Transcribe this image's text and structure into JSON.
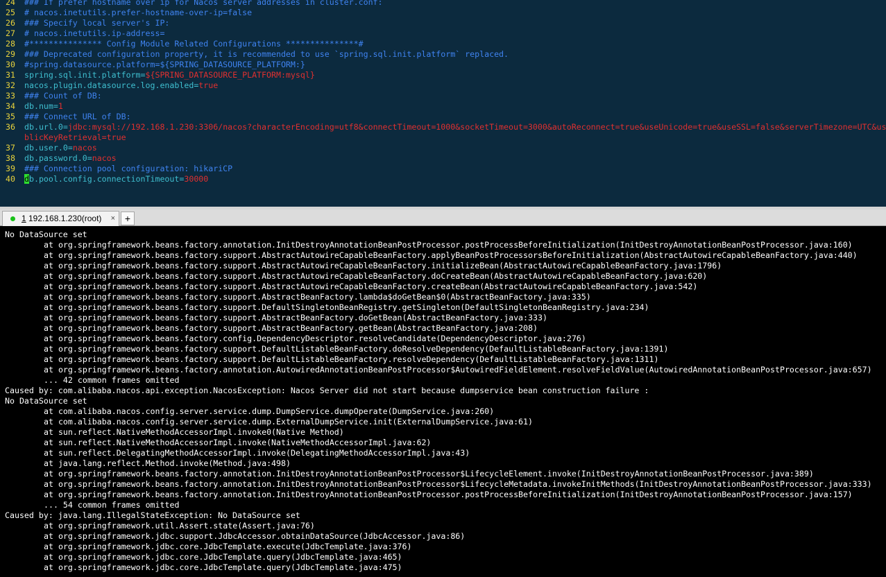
{
  "editor": {
    "lines": [
      {
        "num": "24",
        "kind": "comment",
        "text": "### If prefer hostname over ip for Nacos server addresses in cluster.conf:"
      },
      {
        "num": "25",
        "kind": "comment",
        "text": "# nacos.inetutils.prefer-hostname-over-ip=false"
      },
      {
        "num": "26",
        "kind": "comment",
        "text": "### Specify local server's IP:"
      },
      {
        "num": "27",
        "kind": "comment",
        "text": "# nacos.inetutils.ip-address="
      },
      {
        "num": "28",
        "kind": "comment",
        "text": "#*************** Config Module Related Configurations ***************#"
      },
      {
        "num": "29",
        "kind": "comment",
        "text": "### Deprecated configuration property, it is recommended to use `spring.sql.init.platform` replaced."
      },
      {
        "num": "30",
        "kind": "comment",
        "text": "#spring.datasource.platform=${SPRING_DATASOURCE_PLATFORM:}"
      },
      {
        "num": "31",
        "kind": "kv",
        "key": "spring.sql.init.platform",
        "value": "${SPRING_DATASOURCE_PLATFORM:mysql}"
      },
      {
        "num": "32",
        "kind": "kv",
        "key": "nacos.plugin.datasource.log.enabled",
        "value": "true"
      },
      {
        "num": "33",
        "kind": "comment",
        "text": "### Count of DB:"
      },
      {
        "num": "34",
        "kind": "kv",
        "key": "db.num",
        "value": "1"
      },
      {
        "num": "35",
        "kind": "comment",
        "text": "### Connect URL of DB:"
      },
      {
        "num": "36",
        "kind": "kv",
        "key": "db.url.0",
        "value": "jdbc:mysql://192.168.1.230:3306/nacos?characterEncoding=utf8&connectTimeout=1000&socketTimeout=3000&autoReconnect=true&useUnicode=true&useSSL=false&serverTimezone=UTC&us"
      },
      {
        "num": "",
        "kind": "cont",
        "value": "blicKeyRetrieval=true"
      },
      {
        "num": "37",
        "kind": "kv",
        "key": "db.user.0",
        "value": "nacos"
      },
      {
        "num": "38",
        "kind": "kv",
        "key": "db.password.0",
        "value": "nacos"
      },
      {
        "num": "39",
        "kind": "comment",
        "text": "### Connection pool configuration: hikariCP"
      },
      {
        "num": "40",
        "kind": "kv",
        "cursor": "d",
        "key": "b.pool.config.connectionTimeout",
        "value": "30000"
      }
    ]
  },
  "tab": {
    "number": "1",
    "label": " 192.168.1.230(root)",
    "close_glyph": "×",
    "add_glyph": "+"
  },
  "terminal": {
    "lines": [
      {
        "indent": false,
        "text": "No DataSource set"
      },
      {
        "indent": true,
        "text": "at org.springframework.beans.factory.annotation.InitDestroyAnnotationBeanPostProcessor.postProcessBeforeInitialization(InitDestroyAnnotationBeanPostProcessor.java:160)"
      },
      {
        "indent": true,
        "text": "at org.springframework.beans.factory.support.AbstractAutowireCapableBeanFactory.applyBeanPostProcessorsBeforeInitialization(AbstractAutowireCapableBeanFactory.java:440)"
      },
      {
        "indent": true,
        "text": "at org.springframework.beans.factory.support.AbstractAutowireCapableBeanFactory.initializeBean(AbstractAutowireCapableBeanFactory.java:1796)"
      },
      {
        "indent": true,
        "text": "at org.springframework.beans.factory.support.AbstractAutowireCapableBeanFactory.doCreateBean(AbstractAutowireCapableBeanFactory.java:620)"
      },
      {
        "indent": true,
        "text": "at org.springframework.beans.factory.support.AbstractAutowireCapableBeanFactory.createBean(AbstractAutowireCapableBeanFactory.java:542)"
      },
      {
        "indent": true,
        "text": "at org.springframework.beans.factory.support.AbstractBeanFactory.lambda$doGetBean$0(AbstractBeanFactory.java:335)"
      },
      {
        "indent": true,
        "text": "at org.springframework.beans.factory.support.DefaultSingletonBeanRegistry.getSingleton(DefaultSingletonBeanRegistry.java:234)"
      },
      {
        "indent": true,
        "text": "at org.springframework.beans.factory.support.AbstractBeanFactory.doGetBean(AbstractBeanFactory.java:333)"
      },
      {
        "indent": true,
        "text": "at org.springframework.beans.factory.support.AbstractBeanFactory.getBean(AbstractBeanFactory.java:208)"
      },
      {
        "indent": true,
        "text": "at org.springframework.beans.factory.config.DependencyDescriptor.resolveCandidate(DependencyDescriptor.java:276)"
      },
      {
        "indent": true,
        "text": "at org.springframework.beans.factory.support.DefaultListableBeanFactory.doResolveDependency(DefaultListableBeanFactory.java:1391)"
      },
      {
        "indent": true,
        "text": "at org.springframework.beans.factory.support.DefaultListableBeanFactory.resolveDependency(DefaultListableBeanFactory.java:1311)"
      },
      {
        "indent": true,
        "text": "at org.springframework.beans.factory.annotation.AutowiredAnnotationBeanPostProcessor$AutowiredFieldElement.resolveFieldValue(AutowiredAnnotationBeanPostProcessor.java:657)"
      },
      {
        "indent": true,
        "text": "... 42 common frames omitted"
      },
      {
        "indent": false,
        "text": "Caused by: com.alibaba.nacos.api.exception.NacosException: Nacos Server did not start because dumpservice bean construction failure :"
      },
      {
        "indent": false,
        "text": "No DataSource set"
      },
      {
        "indent": true,
        "text": "at com.alibaba.nacos.config.server.service.dump.DumpService.dumpOperate(DumpService.java:260)"
      },
      {
        "indent": true,
        "text": "at com.alibaba.nacos.config.server.service.dump.ExternalDumpService.init(ExternalDumpService.java:61)"
      },
      {
        "indent": true,
        "text": "at sun.reflect.NativeMethodAccessorImpl.invoke0(Native Method)"
      },
      {
        "indent": true,
        "text": "at sun.reflect.NativeMethodAccessorImpl.invoke(NativeMethodAccessorImpl.java:62)"
      },
      {
        "indent": true,
        "text": "at sun.reflect.DelegatingMethodAccessorImpl.invoke(DelegatingMethodAccessorImpl.java:43)"
      },
      {
        "indent": true,
        "text": "at java.lang.reflect.Method.invoke(Method.java:498)"
      },
      {
        "indent": true,
        "text": "at org.springframework.beans.factory.annotation.InitDestroyAnnotationBeanPostProcessor$LifecycleElement.invoke(InitDestroyAnnotationBeanPostProcessor.java:389)"
      },
      {
        "indent": true,
        "text": "at org.springframework.beans.factory.annotation.InitDestroyAnnotationBeanPostProcessor$LifecycleMetadata.invokeInitMethods(InitDestroyAnnotationBeanPostProcessor.java:333)"
      },
      {
        "indent": true,
        "text": "at org.springframework.beans.factory.annotation.InitDestroyAnnotationBeanPostProcessor.postProcessBeforeInitialization(InitDestroyAnnotationBeanPostProcessor.java:157)"
      },
      {
        "indent": true,
        "text": "... 54 common frames omitted"
      },
      {
        "indent": false,
        "text": "Caused by: java.lang.IllegalStateException: No DataSource set"
      },
      {
        "indent": true,
        "text": "at org.springframework.util.Assert.state(Assert.java:76)"
      },
      {
        "indent": true,
        "text": "at org.springframework.jdbc.support.JdbcAccessor.obtainDataSource(JdbcAccessor.java:86)"
      },
      {
        "indent": true,
        "text": "at org.springframework.jdbc.core.JdbcTemplate.execute(JdbcTemplate.java:376)"
      },
      {
        "indent": true,
        "text": "at org.springframework.jdbc.core.JdbcTemplate.query(JdbcTemplate.java:465)"
      },
      {
        "indent": true,
        "text": "at org.springframework.jdbc.core.JdbcTemplate.query(JdbcTemplate.java:475)"
      }
    ]
  },
  "colors": {
    "editor_bg": "#0c2a3e",
    "line_number": "#e8d23c",
    "comment": "#3f83f0",
    "key": "#3fbfd0",
    "value": "#e03030",
    "cursor": "#2ee02e",
    "tab_status_dot": "#19c119"
  },
  "icons": {
    "tab_status": "status-dot-icon",
    "tab_close": "close-icon",
    "add_tab": "plus-icon"
  }
}
